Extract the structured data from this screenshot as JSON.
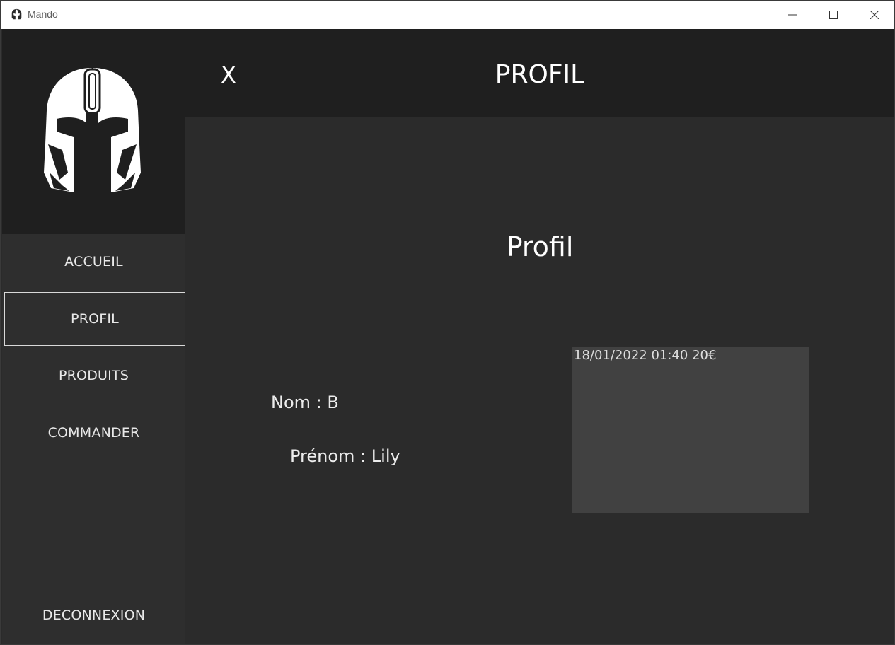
{
  "window": {
    "title": "Mando",
    "icons": {
      "app": "helmet-icon",
      "minimize": "minimize-icon",
      "maximize": "maximize-icon",
      "close": "close-icon"
    }
  },
  "sidebar": {
    "logo": "mandalorian-helmet-logo",
    "items": [
      {
        "label": "ACCUEIL"
      },
      {
        "label": "PROFIL",
        "active": true
      },
      {
        "label": "PRODUITS"
      },
      {
        "label": "COMMANDER"
      }
    ],
    "logout_label": "DECONNEXION"
  },
  "header": {
    "close_label": "X",
    "title": "PROFIL"
  },
  "profile": {
    "section_title": "Profil",
    "nom": "Nom : B",
    "prenom": "Prénom : Lily",
    "orders": [
      "18/01/2022 01:40 20€"
    ]
  },
  "colors": {
    "titlebar_bg": "#ffffff",
    "sidebar_bg": "#2e2e2e",
    "logo_bg": "#1f1f1f",
    "header_bg": "#1f1f1f",
    "main_bg": "#2b2b2b",
    "orders_bg": "#414141",
    "text": "#ffffff"
  }
}
